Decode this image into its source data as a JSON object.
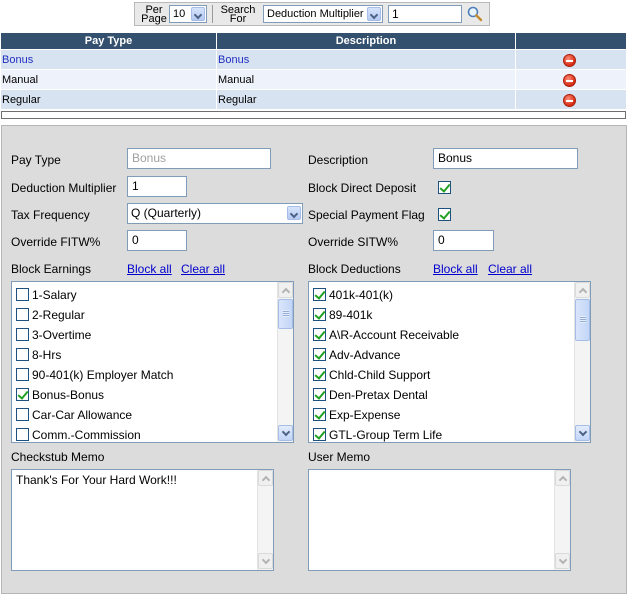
{
  "search": {
    "per_page_label_line1": "Per",
    "per_page_label_line2": "Page",
    "per_page_value": "10",
    "search_for_label_line1": "Search",
    "search_for_label_line2": "For",
    "search_field_value": "Deduction Multiplier",
    "search_text_value": "1",
    "search_icon": "magnifier-icon"
  },
  "grid": {
    "columns": [
      "Pay Type",
      "Description",
      ""
    ],
    "rows": [
      {
        "pay_type": "Bonus",
        "description": "Bonus",
        "selected": true
      },
      {
        "pay_type": "Manual",
        "description": "Manual",
        "selected": false
      },
      {
        "pay_type": "Regular",
        "description": "Regular",
        "selected": false
      }
    ],
    "delete_icon": "delete-icon"
  },
  "form": {
    "pay_type_label": "Pay Type",
    "pay_type_value": "Bonus",
    "description_label": "Description",
    "description_value": "Bonus",
    "deduction_multiplier_label": "Deduction Multiplier",
    "deduction_multiplier_value": "1",
    "block_direct_deposit_label": "Block Direct Deposit",
    "block_direct_deposit_checked": true,
    "tax_frequency_label": "Tax Frequency",
    "tax_frequency_value": "Q (Quarterly)",
    "special_payment_flag_label": "Special Payment Flag",
    "special_payment_flag_checked": true,
    "override_fitw_label": "Override FITW%",
    "override_fitw_value": "0",
    "override_sitw_label": "Override SITW%",
    "override_sitw_value": "0",
    "block_earnings_label": "Block Earnings",
    "block_deductions_label": "Block Deductions",
    "block_all_label": "Block all",
    "clear_all_label": "Clear all",
    "earnings": [
      {
        "label": "1-Salary",
        "checked": false
      },
      {
        "label": "2-Regular",
        "checked": false
      },
      {
        "label": "3-Overtime",
        "checked": false
      },
      {
        "label": "8-Hrs",
        "checked": false
      },
      {
        "label": "90-401(k) Employer Match",
        "checked": false
      },
      {
        "label": "Bonus-Bonus",
        "checked": true
      },
      {
        "label": "Car-Car Allowance",
        "checked": false
      },
      {
        "label": "Comm.-Commission",
        "checked": false
      }
    ],
    "deductions": [
      {
        "label": "401k-401(k)",
        "checked": true
      },
      {
        "label": "89-401k",
        "checked": true
      },
      {
        "label": "A\\R-Account Receivable",
        "checked": true
      },
      {
        "label": "Adv-Advance",
        "checked": true
      },
      {
        "label": "Chld-Child Support",
        "checked": true
      },
      {
        "label": "Den-Pretax Dental",
        "checked": true
      },
      {
        "label": "Exp-Expense",
        "checked": true
      },
      {
        "label": "GTL-Group Term Life",
        "checked": true
      }
    ],
    "checkstub_memo_label": "Checkstub Memo",
    "checkstub_memo_value": "Thank's For Your Hard Work!!!",
    "user_memo_label": "User Memo",
    "user_memo_value": ""
  },
  "colors": {
    "header_bg": "#34506f",
    "row_selected": "#d8e3f2",
    "row_alt": "#eef3fb",
    "panel_bg": "#dcdcdc",
    "link": "#0000cc",
    "selected_text": "#1f2fbf"
  }
}
